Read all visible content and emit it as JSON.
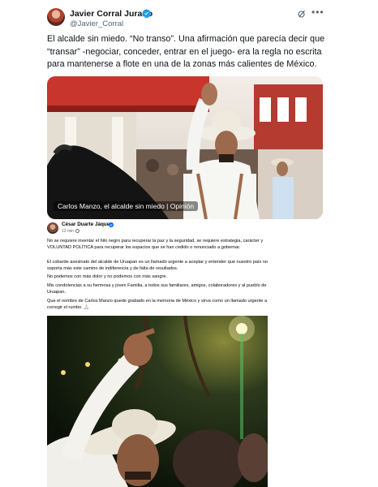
{
  "author": {
    "name": "Javier Corral Jurado",
    "handle": "@Javier_Corral",
    "verified": true
  },
  "tweet": {
    "text": "El alcalde sin miedo. “No transo”. Una afirmación que parecía decir que “transar” -negociar, conceder, entrar en el juego- era la regla no escrita para mantenerse a flote en una de la zonas más calientes de México."
  },
  "link_card": {
    "caption": "Carlos Manzo, el alcalde sin miedo | Opinión"
  },
  "embedded_post": {
    "author": "César Duarte Jáquez",
    "time": "13 min",
    "paragraphs": [
      "No se requiere inventar el hilo negro para recuperar la paz y la seguridad, se requiere estrategia, carácter y VOLUNTAD POLÍTICA para recuperar los espacios que se han cedido o renunciado a gobernar.",
      "El cobarde asesinato del alcalde de Uruapan es un llamado urgente a aceptar y entender que nuestro país no soporta más este camino de indiferencia y de falta de resultados.",
      "No podemos con más dolor y no podemos con más sangre.",
      "Mis condolencias a su hermosa y joven Familia, a todos sus familiares, amigos, colaboradores y al pueblo de Uruapan.",
      "Que el nombre de Carlos Manzo quede grabado en la memoria de México y sirva como un llamado urgente a corregir el rumbo. 🙏🏻"
    ]
  },
  "icons": {
    "verified": "verified-badge-icon",
    "grok": "grok-icon",
    "more": "more-options-icon",
    "globe": "globe-icon"
  },
  "colors": {
    "verified_blue": "#1d9bf0",
    "text": "#0f1419",
    "secondary": "#536471",
    "fb_verified": "#0866ff"
  }
}
